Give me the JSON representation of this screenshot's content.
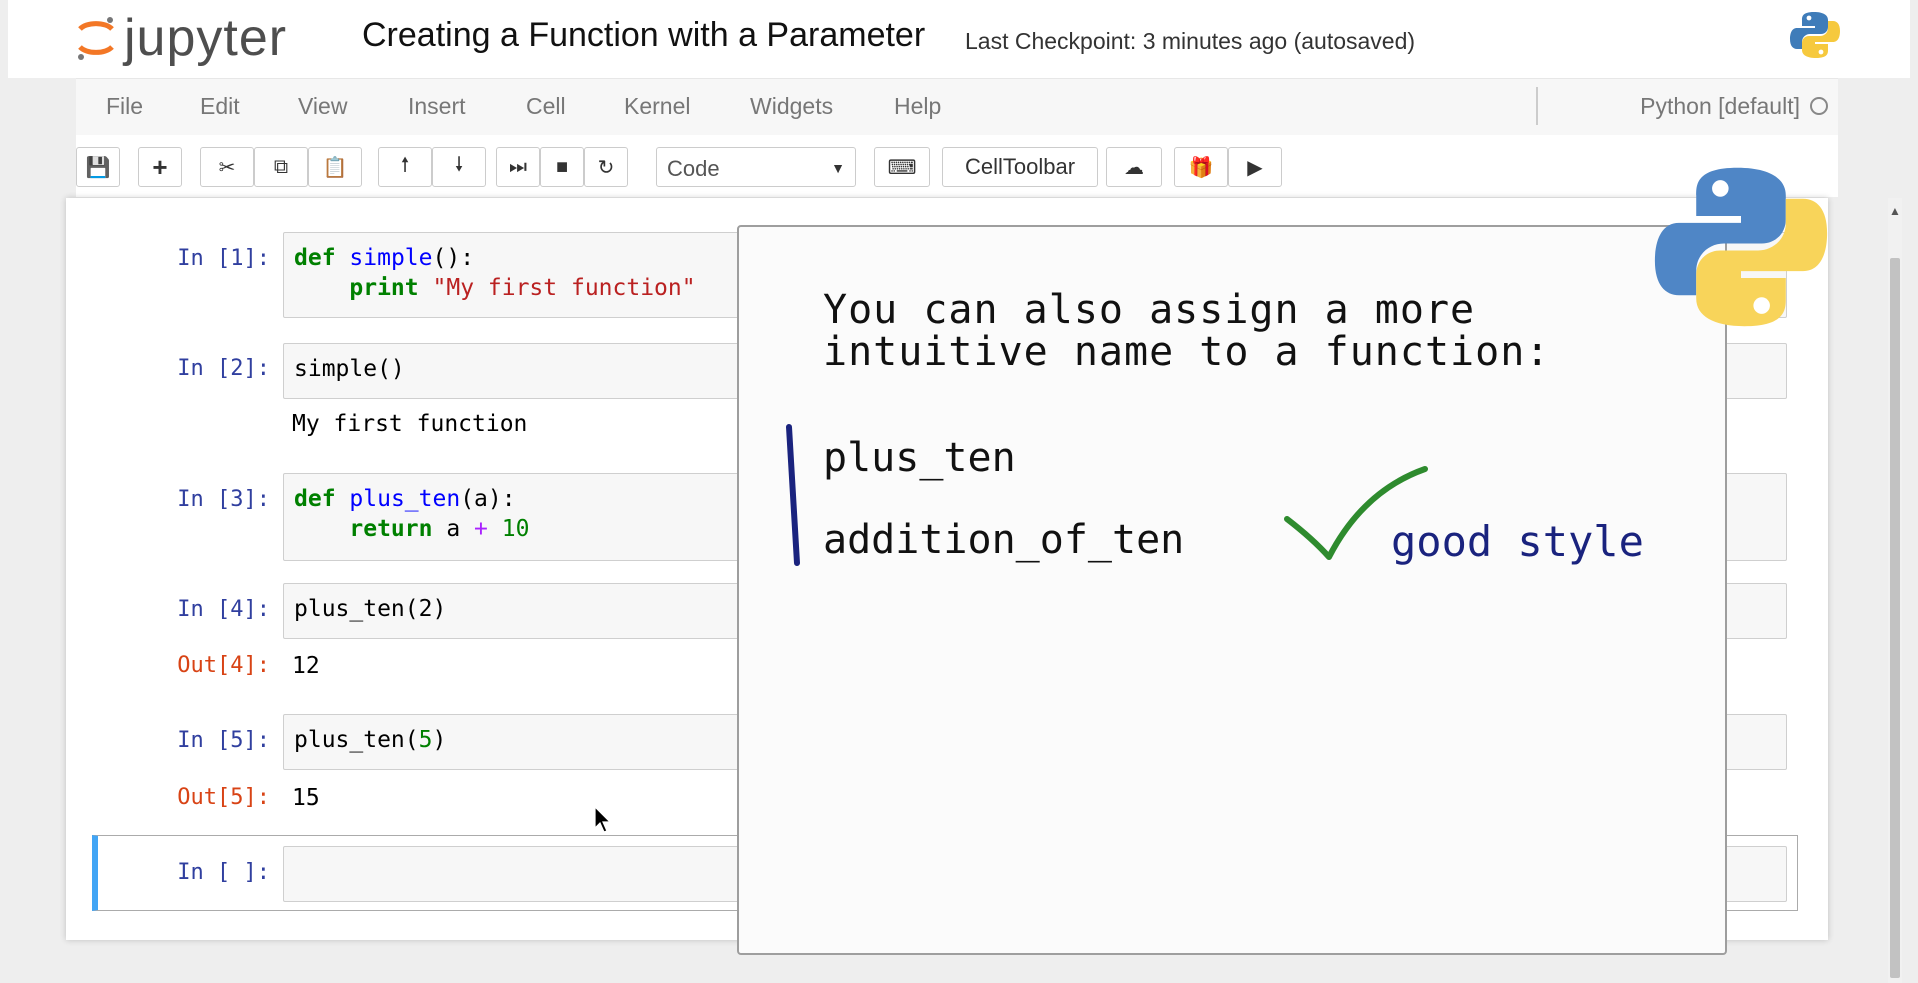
{
  "header": {
    "logo_text": "jupyter",
    "notebook_title": "Creating a Function with a Parameter",
    "checkpoint": "Last Checkpoint: 3 minutes ago (autosaved)"
  },
  "menu": {
    "items": [
      "File",
      "Edit",
      "View",
      "Insert",
      "Cell",
      "Kernel",
      "Widgets",
      "Help"
    ],
    "kernel_name": "Python [default]"
  },
  "toolbar": {
    "cell_type": "Code",
    "celltoolbar_label": "CellToolbar",
    "icons": [
      "save-icon",
      "plus-icon",
      "scissors-icon",
      "copy-icon",
      "paste-icon",
      "arrow-up-icon",
      "arrow-down-icon",
      "step-icon",
      "stop-icon",
      "restart-icon",
      "keyboard-icon",
      "cloud-upload-icon",
      "gift-icon",
      "youtube-icon"
    ]
  },
  "cells": [
    {
      "prompt": "In [1]:",
      "lines": [
        "def simple():",
        "    print \"My first function\""
      ]
    },
    {
      "prompt": "In [2]:",
      "lines": [
        "simple()"
      ],
      "output": "My first function"
    },
    {
      "prompt": "In [3]:",
      "lines": [
        "def plus_ten(a):",
        "    return a + 10"
      ]
    },
    {
      "prompt": "In [4]:",
      "lines": [
        "plus_ten(2)"
      ],
      "out_prompt": "Out[4]:",
      "output": "12"
    },
    {
      "prompt": "In [5]:",
      "lines": [
        "plus_ten(5)"
      ],
      "out_prompt": "Out[5]:",
      "output": "15"
    },
    {
      "prompt": "In [ ]:",
      "lines": [
        ""
      ]
    }
  ],
  "overlay": {
    "heading_line1": "You can also assign a more",
    "heading_line2": "intuitive name to a function:",
    "sample1": "plus_ten",
    "sample2": "addition_of_ten",
    "good_label": "good style",
    "check_color": "#2e8b2e",
    "bar_color": "#1a237e"
  },
  "code_tokens": {
    "def": "def",
    "simple_fn": "simple",
    "simple_tail": "():",
    "print": "print",
    "print_str": "\"My first function\"",
    "plus_ten_fn": "plus_ten",
    "plus_ten_tail": "(a):",
    "return": "return",
    "return_a": " a ",
    "plus_op": "+",
    "ten": " 10",
    "call4": "plus_ten(2)",
    "call5_name": "plus_ten(",
    "call5_arg": "5",
    "call5_close": ")"
  }
}
